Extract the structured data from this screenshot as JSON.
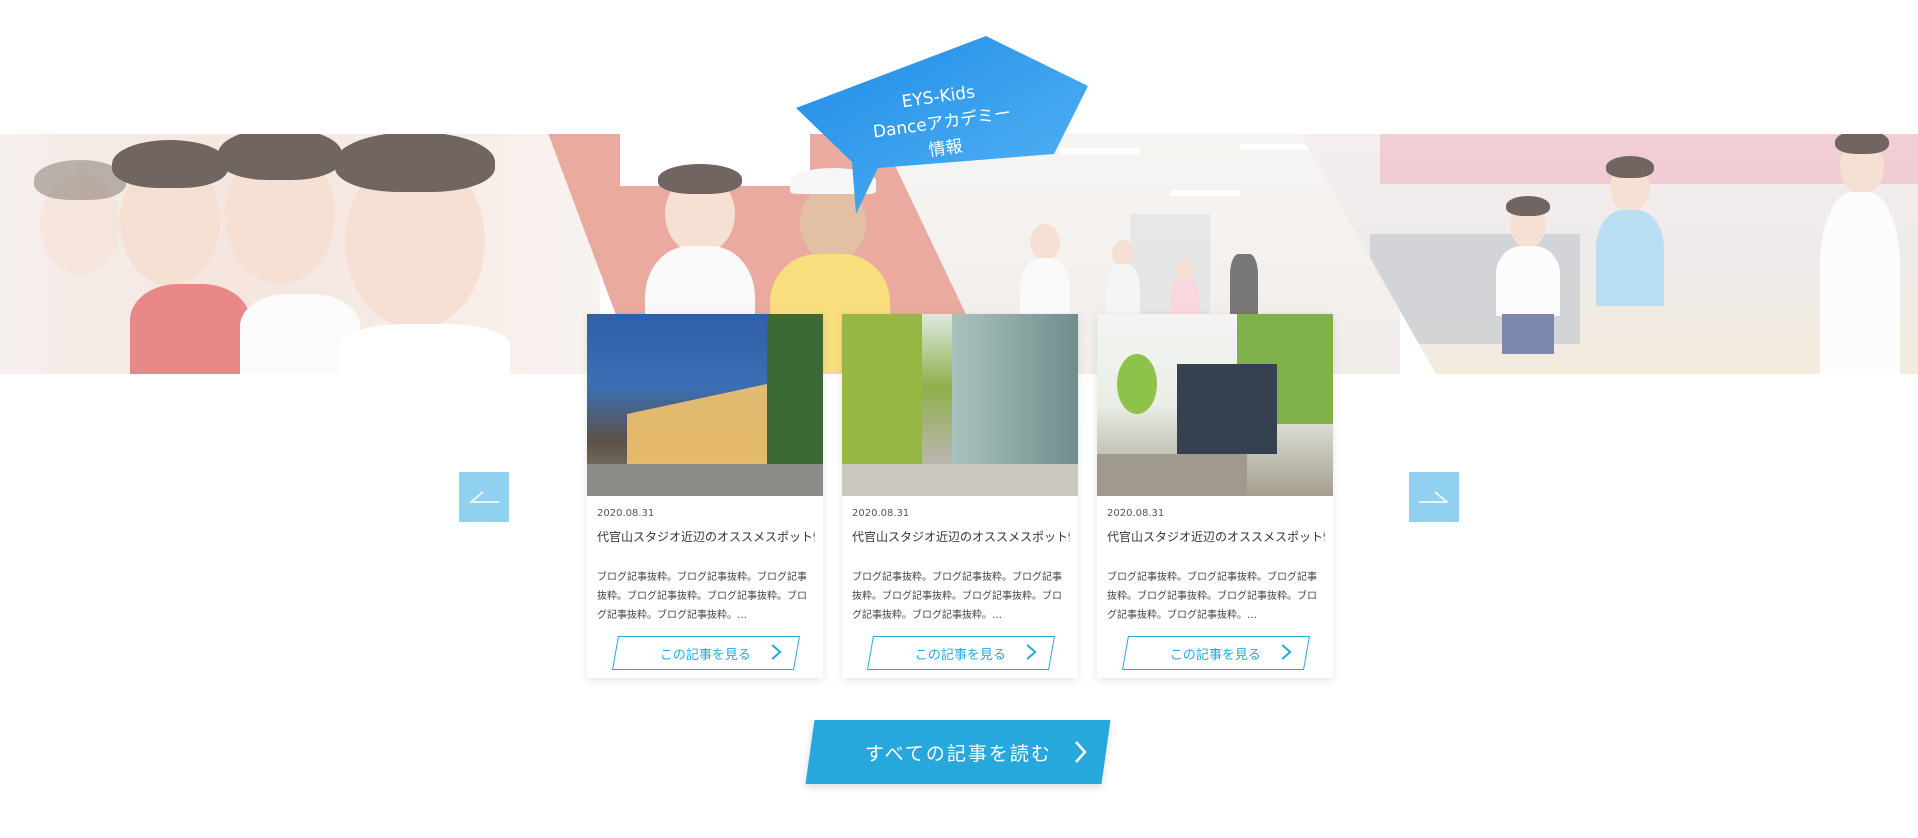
{
  "banner": {
    "bubble_line1": "EYS-Kids",
    "bubble_line2": "Danceアカデミー",
    "bubble_line3": "情報",
    "bubble_color": "#2e95ea"
  },
  "nav": {
    "prev_icon": "arrow-left-icon",
    "next_icon": "arrow-right-icon"
  },
  "cards": [
    {
      "date": "2020.08.31",
      "title": "代官山スタジオ近辺のオススメスポット情",
      "excerpt": "ブログ記事抜粋。ブログ記事抜粋。ブログ記事抜粋。ブログ記事抜粋。ブログ記事抜粋。ブログ記事抜粋。ブログ記事抜粋。…",
      "button": "この記事を見る"
    },
    {
      "date": "2020.08.31",
      "title": "代官山スタジオ近辺のオススメスポット情",
      "excerpt": "ブログ記事抜粋。ブログ記事抜粋。ブログ記事抜粋。ブログ記事抜粋。ブログ記事抜粋。ブログ記事抜粋。ブログ記事抜粋。…",
      "button": "この記事を見る"
    },
    {
      "date": "2020.08.31",
      "title": "代官山スタジオ近辺のオススメスポット情",
      "excerpt": "ブログ記事抜粋。ブログ記事抜粋。ブログ記事抜粋。ブログ記事抜粋。ブログ記事抜粋。ブログ記事抜粋。ブログ記事抜粋。…",
      "button": "この記事を見る"
    }
  ],
  "read_all": {
    "label": "すべての記事を読む"
  },
  "colors": {
    "accent": "#27a8dc",
    "nav": "#8fd1ef"
  }
}
